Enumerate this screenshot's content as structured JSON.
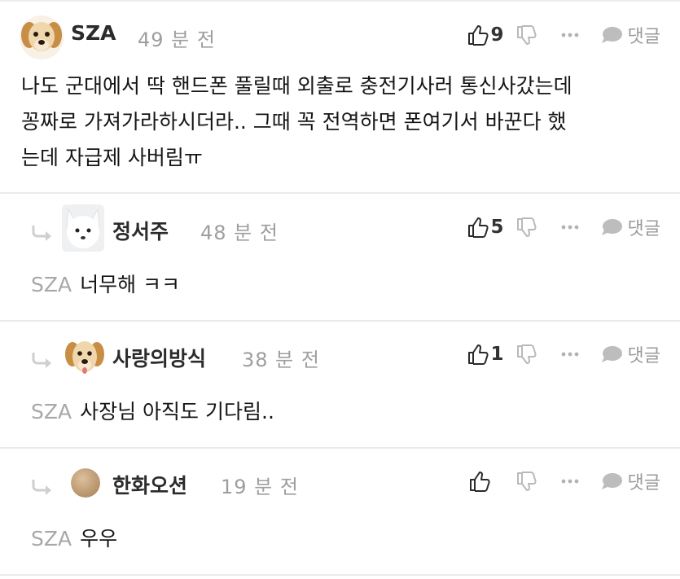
{
  "comments": [
    {
      "username": "SZA",
      "time": "49 분 전",
      "likes": "9",
      "reply_label": "댓글",
      "avatar_icon": "puppy-avatar",
      "text_lines": [
        "나도 군대에서 딱 핸드폰 풀릴때 외출로 충전기사러 통신사갔는데",
        "꽁짜로 가져가라하시더라.. 그때 꼭 전역하면 폰여기서 바꾼다 했",
        "는데 자급제 사버림ㅠ"
      ]
    },
    {
      "username": "정서주",
      "time": "48 분 전",
      "likes": "5",
      "reply_label": "댓글",
      "avatar_icon": "white-fox-avatar",
      "mention": "SZA",
      "text": "너무해 ㅋㅋ"
    },
    {
      "username": "사랑의방식",
      "time": "38 분 전",
      "likes": "1",
      "reply_label": "댓글",
      "avatar_icon": "puppy-avatar",
      "mention": "SZA",
      "text": "사장님 아직도 기다림.."
    },
    {
      "username": "한화오션",
      "time": "19 분 전",
      "likes": "",
      "reply_label": "댓글",
      "avatar_icon": "tan-circle-avatar",
      "mention": "SZA",
      "text": "우우"
    }
  ],
  "icons": {
    "like": "thumbs-up-icon",
    "dislike": "thumbs-down-icon",
    "more": "more-dots-icon",
    "reply": "speech-bubble-icon",
    "reply_arrow": "reply-arrow-icon"
  },
  "colors": {
    "muted": "#9e9e9e",
    "divider": "#ebebeb",
    "mention": "#a8a8a8",
    "avatar_tan": "#c7a57f"
  }
}
